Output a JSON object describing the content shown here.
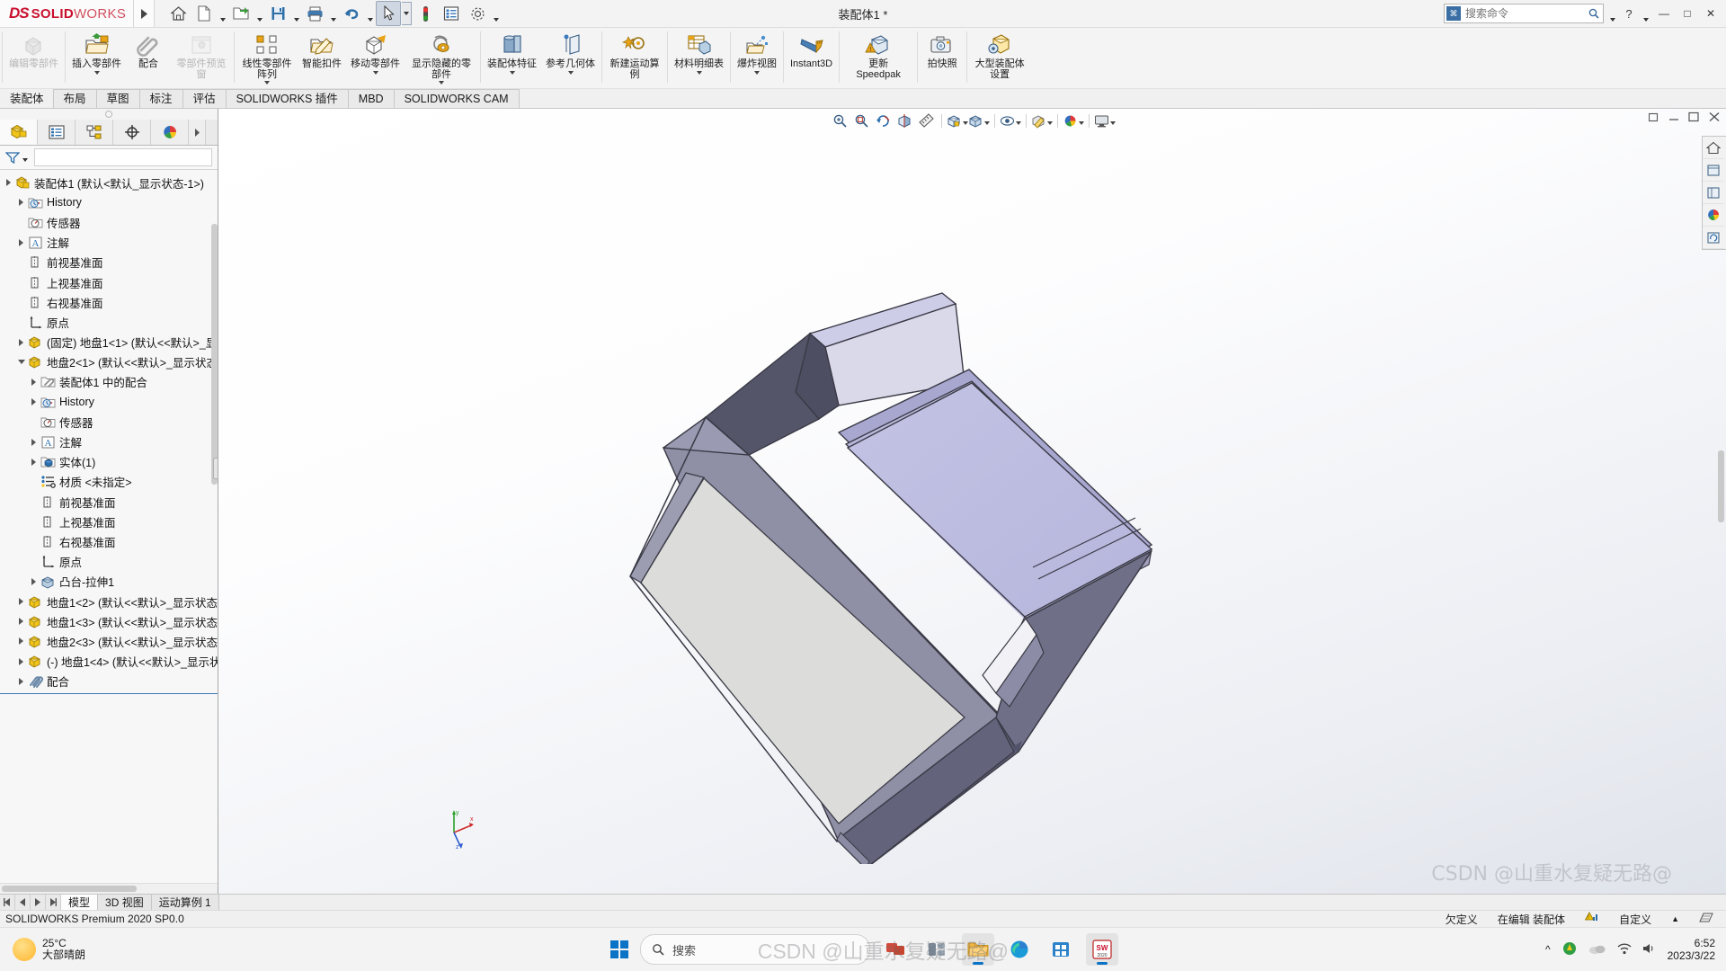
{
  "titlebar": {
    "logo_ds": "DS",
    "logo_solid": "SOLID",
    "logo_works": "WORKS",
    "document_title": "装配体1 *",
    "quick_access": [
      {
        "name": "home-icon",
        "label": "主页"
      },
      {
        "name": "new-document-icon",
        "label": "新建"
      },
      {
        "name": "open-folder-icon",
        "label": "打开"
      },
      {
        "name": "save-icon",
        "label": "保存"
      },
      {
        "name": "print-icon",
        "label": "打印"
      },
      {
        "name": "undo-icon",
        "label": "撤销"
      },
      {
        "name": "select-cursor-icon",
        "label": "选择"
      },
      {
        "name": "rebuild-icon",
        "label": "重建模型"
      },
      {
        "name": "options-list-icon",
        "label": "文件属性"
      },
      {
        "name": "gear-icon",
        "label": "选项"
      }
    ],
    "search_placeholder": "搜索命令",
    "help_label": "?",
    "minimize": "—",
    "maximize": "□",
    "close": "✕"
  },
  "ribbon": {
    "buttons": [
      {
        "label": "编辑零部件",
        "icon": "edit-component-icon",
        "disabled": true,
        "dropdown": false
      },
      {
        "label": "插入零部件",
        "icon": "insert-component-icon",
        "disabled": false,
        "dropdown": true
      },
      {
        "label": "配合",
        "icon": "mate-paperclip-icon",
        "disabled": false,
        "dropdown": false
      },
      {
        "label": "零部件预览窗",
        "icon": "component-preview-icon",
        "disabled": true,
        "dropdown": false
      },
      {
        "label": "线性零部件阵列",
        "icon": "linear-pattern-icon",
        "disabled": false,
        "dropdown": true
      },
      {
        "label": "智能扣件",
        "icon": "smart-fastener-icon",
        "disabled": false,
        "dropdown": false
      },
      {
        "label": "移动零部件",
        "icon": "move-component-icon",
        "disabled": false,
        "dropdown": true
      },
      {
        "label": "显示隐藏的零部件",
        "icon": "show-hidden-components-icon",
        "disabled": false,
        "dropdown": true
      },
      {
        "label": "装配体特征",
        "icon": "assembly-feature-icon",
        "disabled": false,
        "dropdown": true
      },
      {
        "label": "参考几何体",
        "icon": "reference-geometry-icon",
        "disabled": false,
        "dropdown": true
      },
      {
        "label": "新建运动算例",
        "icon": "new-motion-study-icon",
        "disabled": false,
        "dropdown": false
      },
      {
        "label": "材料明细表",
        "icon": "bill-of-materials-icon",
        "disabled": false,
        "dropdown": true
      },
      {
        "label": "爆炸视图",
        "icon": "exploded-view-icon",
        "disabled": false,
        "dropdown": true
      },
      {
        "label": "Instant3D",
        "icon": "instant3d-icon",
        "disabled": false,
        "dropdown": false
      },
      {
        "label": "更新 Speedpak",
        "icon": "update-speedpak-icon",
        "disabled": false,
        "dropdown": false
      },
      {
        "label": "拍快照",
        "icon": "take-snapshot-icon",
        "disabled": false,
        "dropdown": false
      },
      {
        "label": "大型装配体设置",
        "icon": "large-assembly-settings-icon",
        "disabled": false,
        "dropdown": false
      }
    ]
  },
  "tabs": [
    {
      "label": "装配体",
      "active": true
    },
    {
      "label": "布局",
      "active": false
    },
    {
      "label": "草图",
      "active": false
    },
    {
      "label": "标注",
      "active": false
    },
    {
      "label": "评估",
      "active": false
    },
    {
      "label": "SOLIDWORKS 插件",
      "active": false
    },
    {
      "label": "MBD",
      "active": false
    },
    {
      "label": "SOLIDWORKS CAM",
      "active": false
    }
  ],
  "feature_manager": {
    "panel_tabs": [
      {
        "name": "feature-tree-tab",
        "icon": "yellow-cube-icon",
        "active": true
      },
      {
        "name": "property-manager-tab",
        "icon": "property-list-icon",
        "active": false
      },
      {
        "name": "configuration-manager-tab",
        "icon": "configuration-icon",
        "active": false
      },
      {
        "name": "dimxpert-tab",
        "icon": "dimxpert-target-icon",
        "active": false
      },
      {
        "name": "display-manager-tab",
        "icon": "color-sphere-icon",
        "active": false
      },
      {
        "name": "more-tabs",
        "icon": "chevron-right-icon",
        "active": false
      }
    ],
    "filter_placeholder": "",
    "tree": [
      {
        "depth": 0,
        "arrow": "right",
        "icon": "assembly-icon",
        "label": "装配体1  (默认<默认_显示状态-1>)"
      },
      {
        "depth": 1,
        "arrow": "right",
        "icon": "history-icon",
        "label": "History"
      },
      {
        "depth": 1,
        "arrow": "none",
        "icon": "sensor-icon",
        "label": "传感器"
      },
      {
        "depth": 1,
        "arrow": "right",
        "icon": "annotation-icon",
        "label": "注解"
      },
      {
        "depth": 1,
        "arrow": "none",
        "icon": "plane-icon",
        "label": "前视基准面"
      },
      {
        "depth": 1,
        "arrow": "none",
        "icon": "plane-icon",
        "label": "上视基准面"
      },
      {
        "depth": 1,
        "arrow": "none",
        "icon": "plane-icon",
        "label": "右视基准面"
      },
      {
        "depth": 1,
        "arrow": "none",
        "icon": "origin-icon",
        "label": "原点"
      },
      {
        "depth": 1,
        "arrow": "right",
        "icon": "part-icon",
        "label": "(固定) 地盘1<1> (默认<<默认>_显"
      },
      {
        "depth": 1,
        "arrow": "down",
        "icon": "part-icon",
        "label": "地盘2<1> (默认<<默认>_显示状态"
      },
      {
        "depth": 2,
        "arrow": "right",
        "icon": "mates-folder-icon",
        "label": "装配体1 中的配合"
      },
      {
        "depth": 2,
        "arrow": "right",
        "icon": "history-icon",
        "label": "History"
      },
      {
        "depth": 2,
        "arrow": "none",
        "icon": "sensor-icon",
        "label": "传感器"
      },
      {
        "depth": 2,
        "arrow": "right",
        "icon": "annotation-icon",
        "label": "注解"
      },
      {
        "depth": 2,
        "arrow": "right",
        "icon": "solid-bodies-icon",
        "label": "实体(1)"
      },
      {
        "depth": 2,
        "arrow": "none",
        "icon": "material-icon",
        "label": "材质 <未指定>"
      },
      {
        "depth": 2,
        "arrow": "none",
        "icon": "plane-icon",
        "label": "前视基准面"
      },
      {
        "depth": 2,
        "arrow": "none",
        "icon": "plane-icon",
        "label": "上视基准面"
      },
      {
        "depth": 2,
        "arrow": "none",
        "icon": "plane-icon",
        "label": "右视基准面"
      },
      {
        "depth": 2,
        "arrow": "none",
        "icon": "origin-icon",
        "label": "原点"
      },
      {
        "depth": 2,
        "arrow": "right",
        "icon": "boss-extrude-icon",
        "label": "凸台-拉伸1"
      },
      {
        "depth": 1,
        "arrow": "right",
        "icon": "part-icon",
        "label": "地盘1<2> (默认<<默认>_显示状态"
      },
      {
        "depth": 1,
        "arrow": "right",
        "icon": "part-icon",
        "label": "地盘1<3> (默认<<默认>_显示状态"
      },
      {
        "depth": 1,
        "arrow": "right",
        "icon": "part-icon",
        "label": "地盘2<3> (默认<<默认>_显示状态"
      },
      {
        "depth": 1,
        "arrow": "right",
        "icon": "part-icon",
        "label": "(-) 地盘1<4> (默认<<默认>_显示状"
      },
      {
        "depth": 1,
        "arrow": "right",
        "icon": "mates-icon",
        "label": "配合"
      }
    ]
  },
  "graphics_toolbar": {
    "buttons": [
      {
        "name": "zoom-to-fit-icon",
        "dropdown": false
      },
      {
        "name": "zoom-to-area-icon",
        "dropdown": false
      },
      {
        "name": "previous-view-icon",
        "dropdown": false
      },
      {
        "name": "section-view-icon",
        "dropdown": false
      },
      {
        "name": "measure-icon",
        "dropdown": false
      },
      {
        "name": "view-orientation-icon",
        "dropdown": true
      },
      {
        "name": "display-style-icon",
        "dropdown": true
      },
      {
        "name": "hide-show-items-icon",
        "dropdown": true
      },
      {
        "name": "edit-appearance-icon",
        "dropdown": true
      },
      {
        "name": "apply-scene-icon",
        "dropdown": true
      },
      {
        "name": "view-settings-icon",
        "dropdown": true
      }
    ],
    "window_controls": [
      "restore-icon",
      "minimize-icon",
      "maximize-icon",
      "close-icon"
    ]
  },
  "right_toolbar": [
    {
      "name": "view-home-icon"
    },
    {
      "name": "view-front-icon"
    },
    {
      "name": "view-left-icon"
    },
    {
      "name": "appearance-sphere-icon"
    },
    {
      "name": "view-rotate-icon"
    }
  ],
  "triad": {
    "x": "x",
    "y": "y",
    "z": "z"
  },
  "watermark": "CSDN @山重水复疑无路@",
  "bottom_tabs": [
    {
      "label": "模型",
      "active": true
    },
    {
      "label": "3D 视图",
      "active": false
    },
    {
      "label": "运动算例 1",
      "active": false
    }
  ],
  "statusbar": {
    "version": "SOLIDWORKS Premium 2020 SP0.0",
    "state": "欠定义",
    "editing": "在编辑 装配体",
    "custom": "自定义",
    "caret": "▲",
    "overlay_icon": "rebuild-warning-icon",
    "overlay_icon2": "tilde-icon"
  },
  "taskbar": {
    "weather_temp": "25°C",
    "weather_desc": "大部晴朗",
    "search_placeholder": "搜索",
    "apps": [
      {
        "name": "taskview-icon",
        "label": "任务视图"
      },
      {
        "name": "widgets-icon",
        "label": "小组件"
      },
      {
        "name": "file-explorer-icon",
        "label": "文件资源管理器",
        "active": true
      },
      {
        "name": "edge-browser-icon",
        "label": "Microsoft Edge"
      },
      {
        "name": "store-icon",
        "label": "应用商店"
      },
      {
        "name": "solidworks-app-icon",
        "label": "SOLIDWORKS",
        "active": true
      }
    ],
    "tray_caret": "^",
    "clock_time": "6:52",
    "clock_date": "2023/3/22"
  }
}
